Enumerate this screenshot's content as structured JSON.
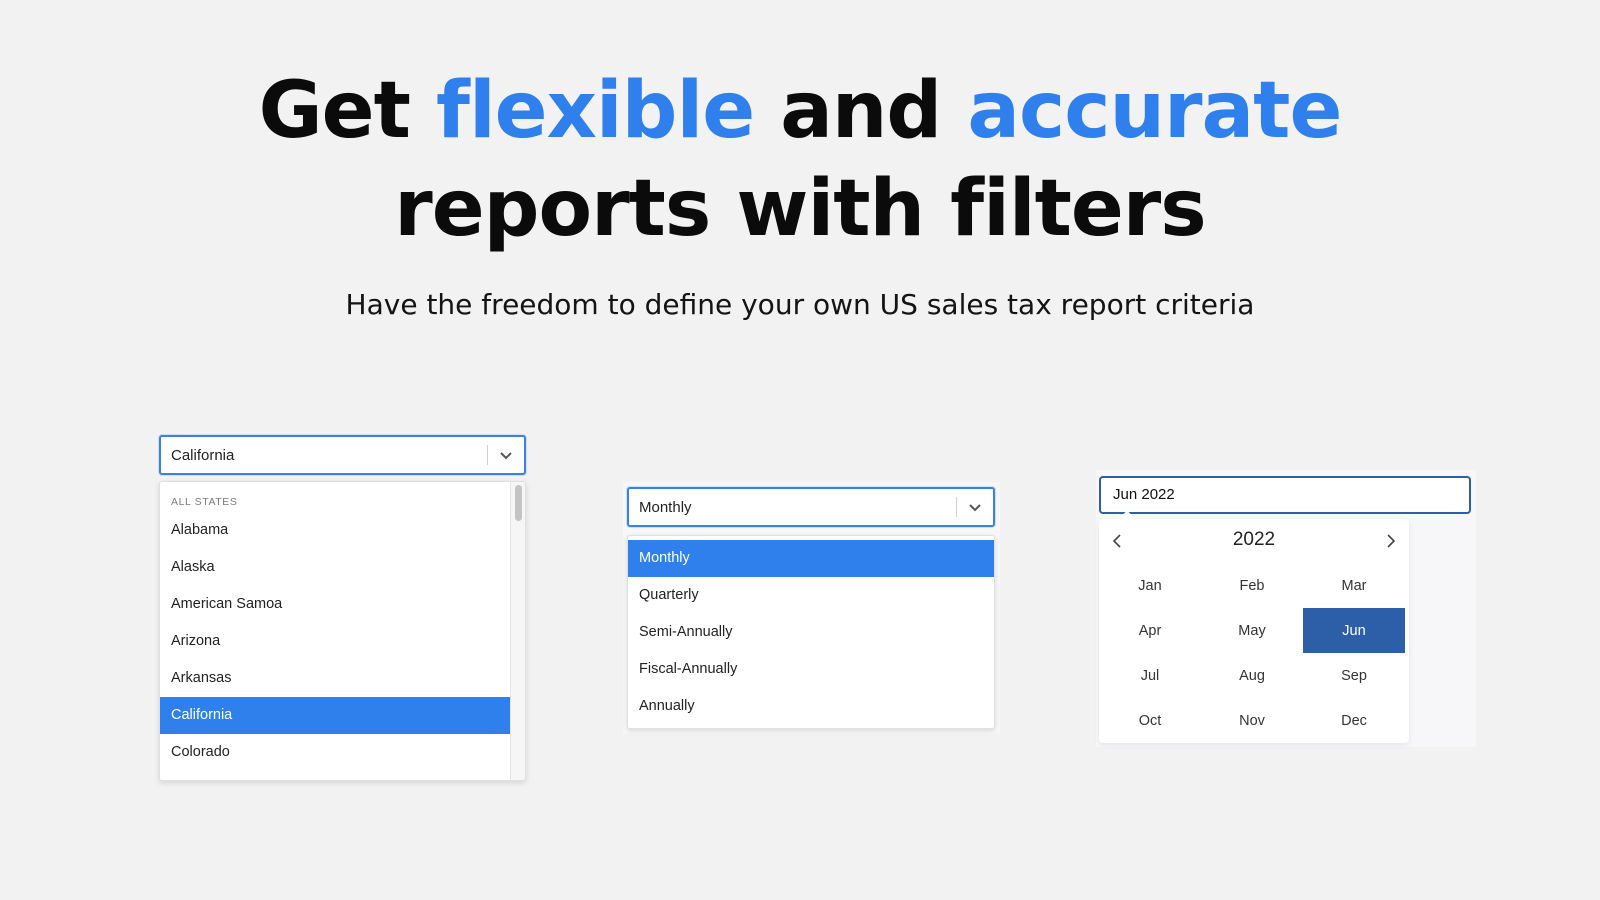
{
  "hero": {
    "line1_part1": "Get ",
    "line1_accent1": "flexible",
    "line1_part2": " and ",
    "line1_accent2": "accurate",
    "line2": "reports with filters",
    "subtitle": "Have the freedom to define your own US sales tax report criteria",
    "accent_color": "#2f80ed"
  },
  "state_select": {
    "value": "California",
    "group_label": "ALL STATES",
    "options": [
      "Alabama",
      "Alaska",
      "American Samoa",
      "Arizona",
      "Arkansas",
      "California",
      "Colorado"
    ],
    "selected": "California",
    "icon": "chevron-down-icon"
  },
  "period_select": {
    "value": "Monthly",
    "options": [
      "Monthly",
      "Quarterly",
      "Semi-Annually",
      "Fiscal-Annually",
      "Annually"
    ],
    "selected": "Monthly",
    "icon": "chevron-down-icon"
  },
  "month_picker": {
    "value": "Jun 2022",
    "year": "2022",
    "months": [
      "Jan",
      "Feb",
      "Mar",
      "Apr",
      "May",
      "Jun",
      "Jul",
      "Aug",
      "Sep",
      "Oct",
      "Nov",
      "Dec"
    ],
    "selected": "Jun",
    "prev_icon": "chevron-left-icon",
    "next_icon": "chevron-right-icon",
    "selected_color": "#2d5fa8"
  }
}
